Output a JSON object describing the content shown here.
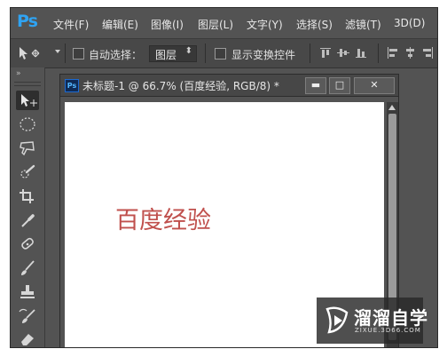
{
  "app": {
    "logo": "Ps"
  },
  "menu": [
    "文件(F)",
    "编辑(E)",
    "图像(I)",
    "图层(L)",
    "文字(Y)",
    "选择(S)",
    "滤镜(T)",
    "3D(D)"
  ],
  "options_bar": {
    "auto_select_label": "自动选择：",
    "auto_select_checked": false,
    "layer_dropdown_value": "图层",
    "show_transform_label": "显示变换控件",
    "show_transform_checked": false
  },
  "toolbar": {
    "collapse_glyph": "»",
    "tools": [
      {
        "name": "move-tool",
        "icon": "move-icon",
        "active": true
      },
      {
        "name": "elliptical-marquee-tool",
        "icon": "ellipse-marquee-icon"
      },
      {
        "name": "polygonal-lasso-tool",
        "icon": "lasso-icon"
      },
      {
        "name": "quick-selection-tool",
        "icon": "quick-selection-icon"
      },
      {
        "name": "crop-tool",
        "icon": "crop-icon"
      },
      {
        "name": "eyedropper-tool",
        "icon": "eyedropper-icon"
      },
      {
        "name": "spot-healing-tool",
        "icon": "bandage-icon"
      },
      {
        "name": "brush-tool",
        "icon": "brush-icon"
      },
      {
        "name": "clone-stamp-tool",
        "icon": "stamp-icon"
      },
      {
        "name": "history-brush-tool",
        "icon": "history-brush-icon"
      },
      {
        "name": "eraser-tool",
        "icon": "eraser-icon"
      }
    ]
  },
  "document": {
    "icon_label": "Ps",
    "title": "未标题-1 @ 66.7% (百度经验, RGB/8) *",
    "canvas_text": "百度经验",
    "canvas_text_color": "#c0504d",
    "min_glyph": "▬",
    "max_glyph": "□",
    "close_glyph": "✕"
  },
  "watermark": {
    "name": "溜溜自学",
    "url": "ZIXUE.3D66.COM"
  },
  "colors": {
    "ui_bg": "#535353",
    "accent": "#2fa3f2"
  }
}
